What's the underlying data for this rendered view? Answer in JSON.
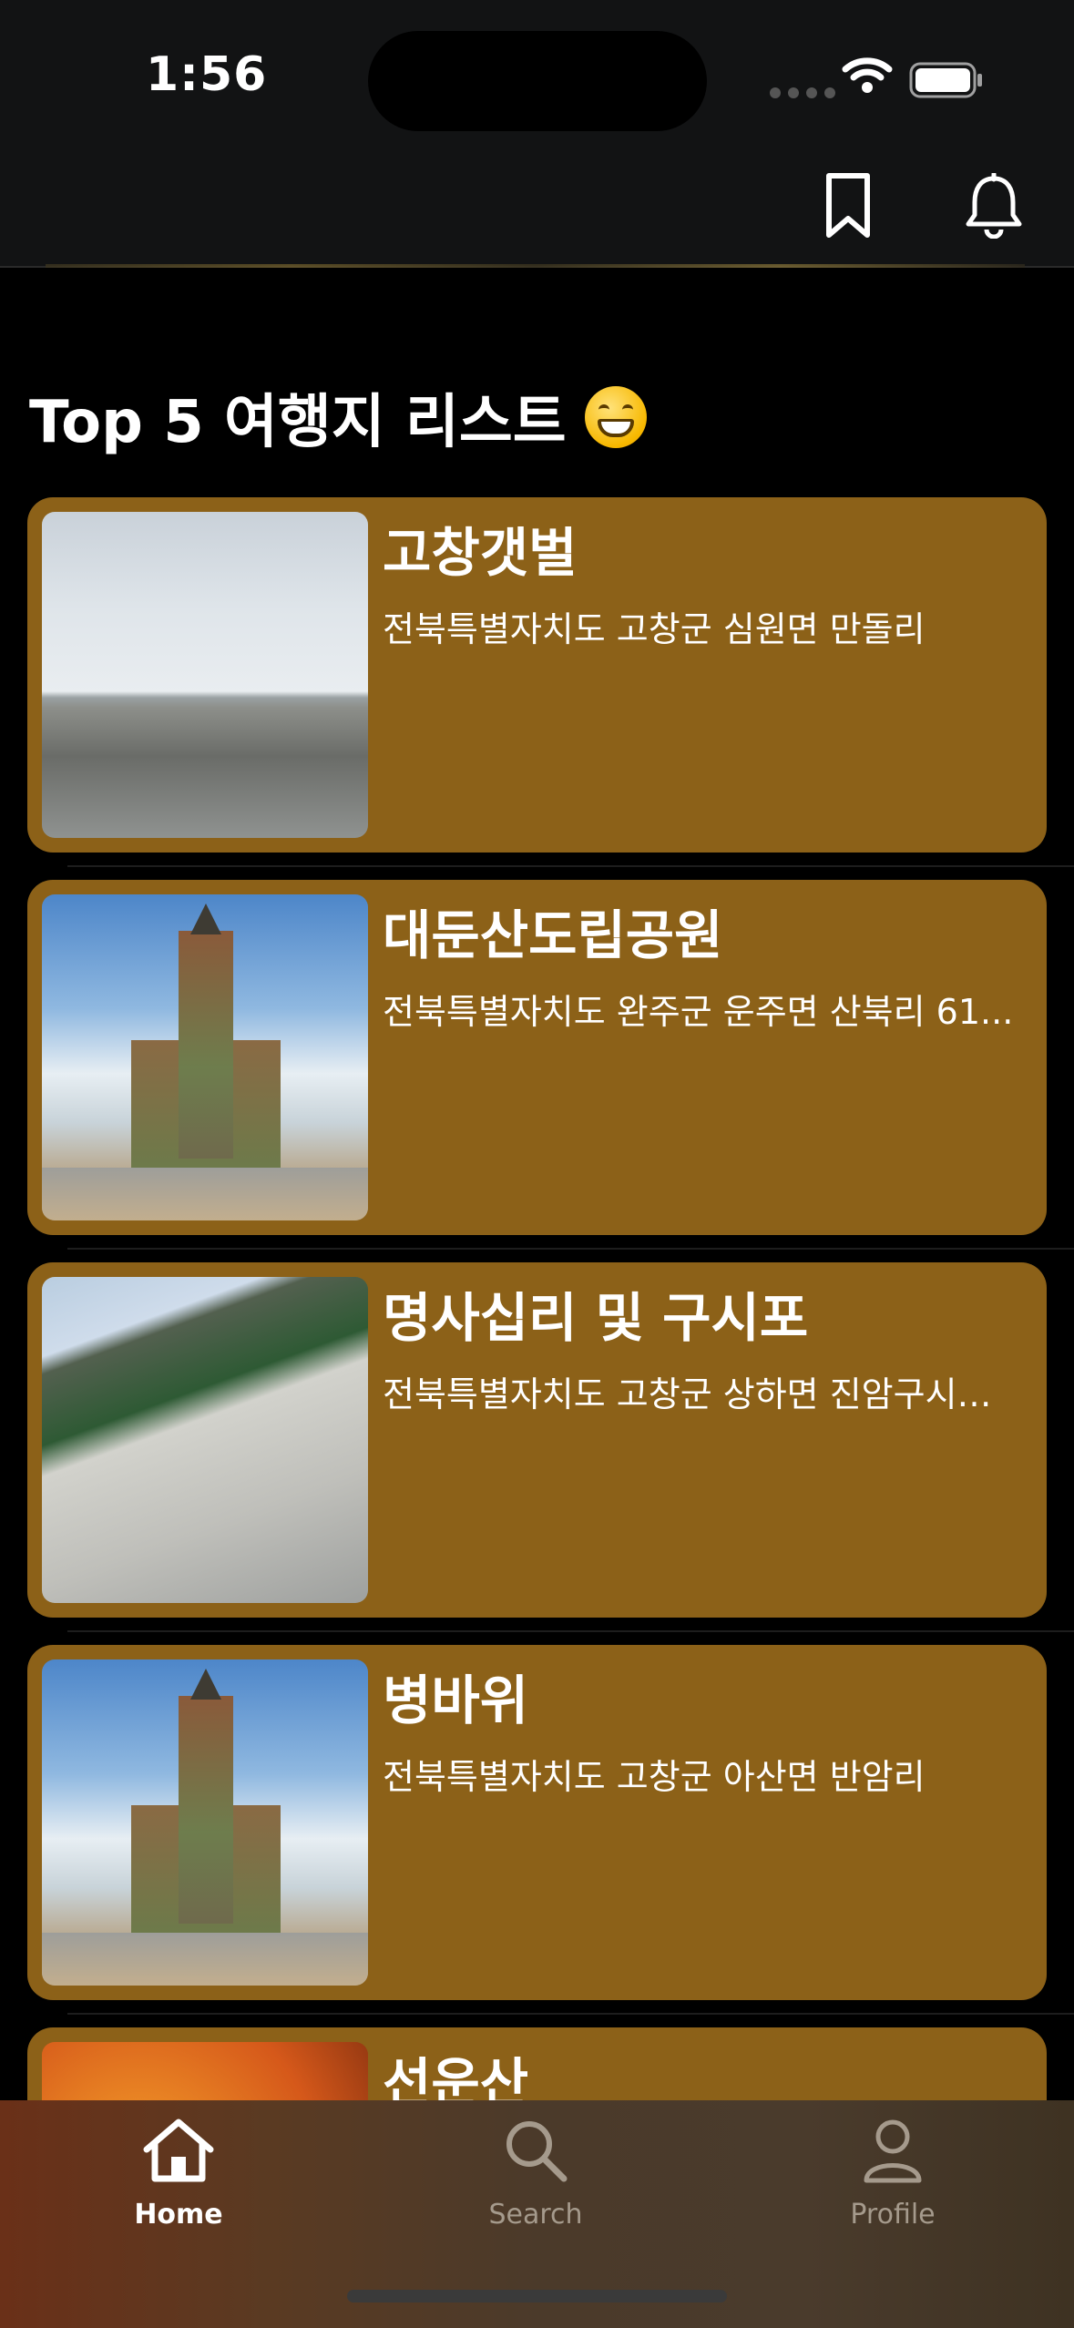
{
  "status_bar": {
    "time": "1:56"
  },
  "header": {
    "bookmark_icon": "bookmark-icon",
    "bell_icon": "bell-icon"
  },
  "section": {
    "title": "Top 5 여행지 리스트",
    "emoji": "grinning-face-emoji"
  },
  "places": [
    {
      "name": "고창갯벌",
      "address": "전북특별자치도 고창군 심원면 만돌리",
      "image": "mudflat"
    },
    {
      "name": "대둔산도립공원",
      "address": "전북특별자치도 완주군 운주면 산북리 61...",
      "image": "church"
    },
    {
      "name": "명사십리 및 구시포",
      "address": "전북특별자치도 고창군 상하면 진암구시…",
      "image": "beach"
    },
    {
      "name": "병바위",
      "address": "전북특별자치도 고창군 아산면 반암리",
      "image": "church"
    },
    {
      "name": "선운산",
      "address": "",
      "image": "autumn"
    }
  ],
  "tabbar": {
    "tabs": [
      {
        "label": "Home",
        "icon": "house-icon",
        "active": true
      },
      {
        "label": "Search",
        "icon": "magnifier-icon",
        "active": false
      },
      {
        "label": "Profile",
        "icon": "person-icon",
        "active": false
      }
    ]
  }
}
